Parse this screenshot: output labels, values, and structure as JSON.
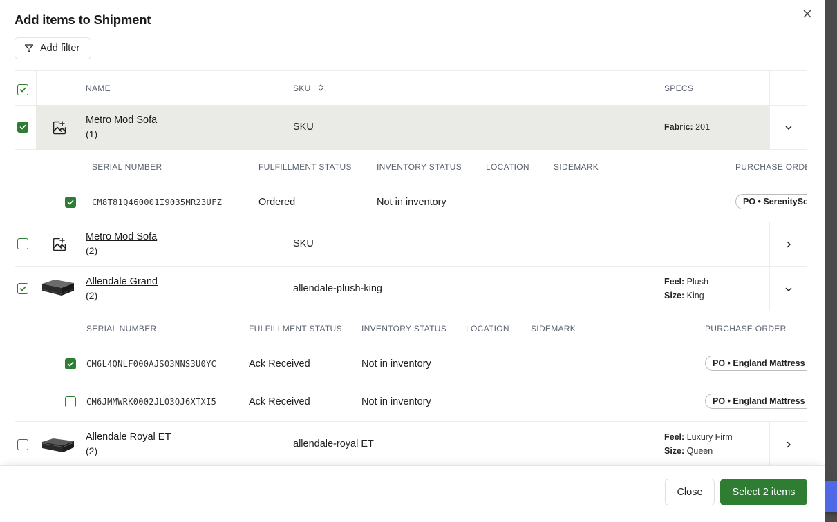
{
  "modal": {
    "title": "Add items to Shipment",
    "filter_label": "Add filter"
  },
  "table": {
    "columns": {
      "name": "NAME",
      "sku": "SKU",
      "specs": "SPECS"
    },
    "sub_columns": {
      "serial": "SERIAL NUMBER",
      "fulfillment": "FULFILLMENT STATUS",
      "inventory": "INVENTORY STATUS",
      "location": "LOCATION",
      "sidemark": "SIDEMARK",
      "purchase_order_truncated": "PURCHASE ORDER",
      "purchase_order": "PURCHASE ORDER"
    },
    "products": [
      {
        "name": "Metro Mod Sofa",
        "count": "(1)",
        "sku": "SKU",
        "checked": true,
        "expanded": true,
        "specs": [
          {
            "key": "Fabric:",
            "value": "201"
          }
        ],
        "units": [
          {
            "serial": "CM8T81Q460001I9035MR23UFZ",
            "fulfillment": "Ordered",
            "inventory": "Not in inventory",
            "po": "PO • SerenitySo",
            "checked": true
          }
        ]
      },
      {
        "name": "Metro Mod Sofa",
        "count": "(2)",
        "sku": "SKU",
        "checked": false,
        "expanded": false,
        "specs": []
      },
      {
        "name": "Allendale Grand",
        "count": "(2)",
        "sku": "allendale-plush-king",
        "checked": "partial",
        "expanded": true,
        "specs": [
          {
            "key": "Feel:",
            "value": "Plush"
          },
          {
            "key": "Size:",
            "value": "King"
          }
        ],
        "units": [
          {
            "serial": "CM6L4QNLF000AJS03NNS3U0YC",
            "fulfillment": "Ack Received",
            "inventory": "Not in inventory",
            "po": "PO • England Mattress",
            "checked": true
          },
          {
            "serial": "CM6JMMWRK0002JL03QJ6XTXI5",
            "fulfillment": "Ack Received",
            "inventory": "Not in inventory",
            "po": "PO • England Mattress",
            "checked": false
          }
        ]
      },
      {
        "name": "Allendale Royal ET",
        "count": "(2)",
        "sku": "allendale-royal ET",
        "checked": false,
        "expanded": false,
        "specs": [
          {
            "key": "Feel:",
            "value": "Luxury Firm"
          },
          {
            "key": "Size:",
            "value": "Queen"
          }
        ]
      }
    ]
  },
  "footer": {
    "close_label": "Close",
    "select_label": "Select 2 items"
  },
  "colors": {
    "accent": "#2e7d32",
    "selected_row": "#eaebe6",
    "backdrop": "#4a4a4a"
  }
}
